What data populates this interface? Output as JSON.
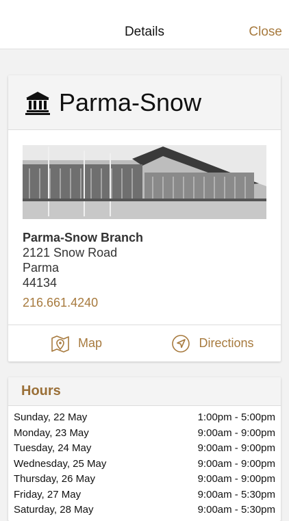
{
  "nav": {
    "title": "Details",
    "close_label": "Close"
  },
  "branch": {
    "title": "Parma-Snow",
    "full_name": "Parma-Snow Branch",
    "address_line1": "2121 Snow Road",
    "city": "Parma",
    "zip": "44134",
    "phone": "216.661.4240",
    "photo_icon": "library-building-photo"
  },
  "actions": {
    "map_label": "Map",
    "directions_label": "Directions"
  },
  "hours": {
    "title": "Hours",
    "rows": [
      {
        "day": "Sunday, 22 May",
        "time": "1:00pm - 5:00pm"
      },
      {
        "day": "Monday, 23 May",
        "time": "9:00am - 9:00pm"
      },
      {
        "day": "Tuesday, 24 May",
        "time": "9:00am - 9:00pm"
      },
      {
        "day": "Wednesday, 25 May",
        "time": "9:00am - 9:00pm"
      },
      {
        "day": "Thursday, 26 May",
        "time": "9:00am - 9:00pm"
      },
      {
        "day": "Friday, 27 May",
        "time": "9:00am - 5:30pm"
      },
      {
        "day": "Saturday, 28 May",
        "time": "9:00am - 5:30pm"
      }
    ]
  },
  "colors": {
    "accent": "#a77a3e",
    "hours_title": "#9a6f37"
  }
}
